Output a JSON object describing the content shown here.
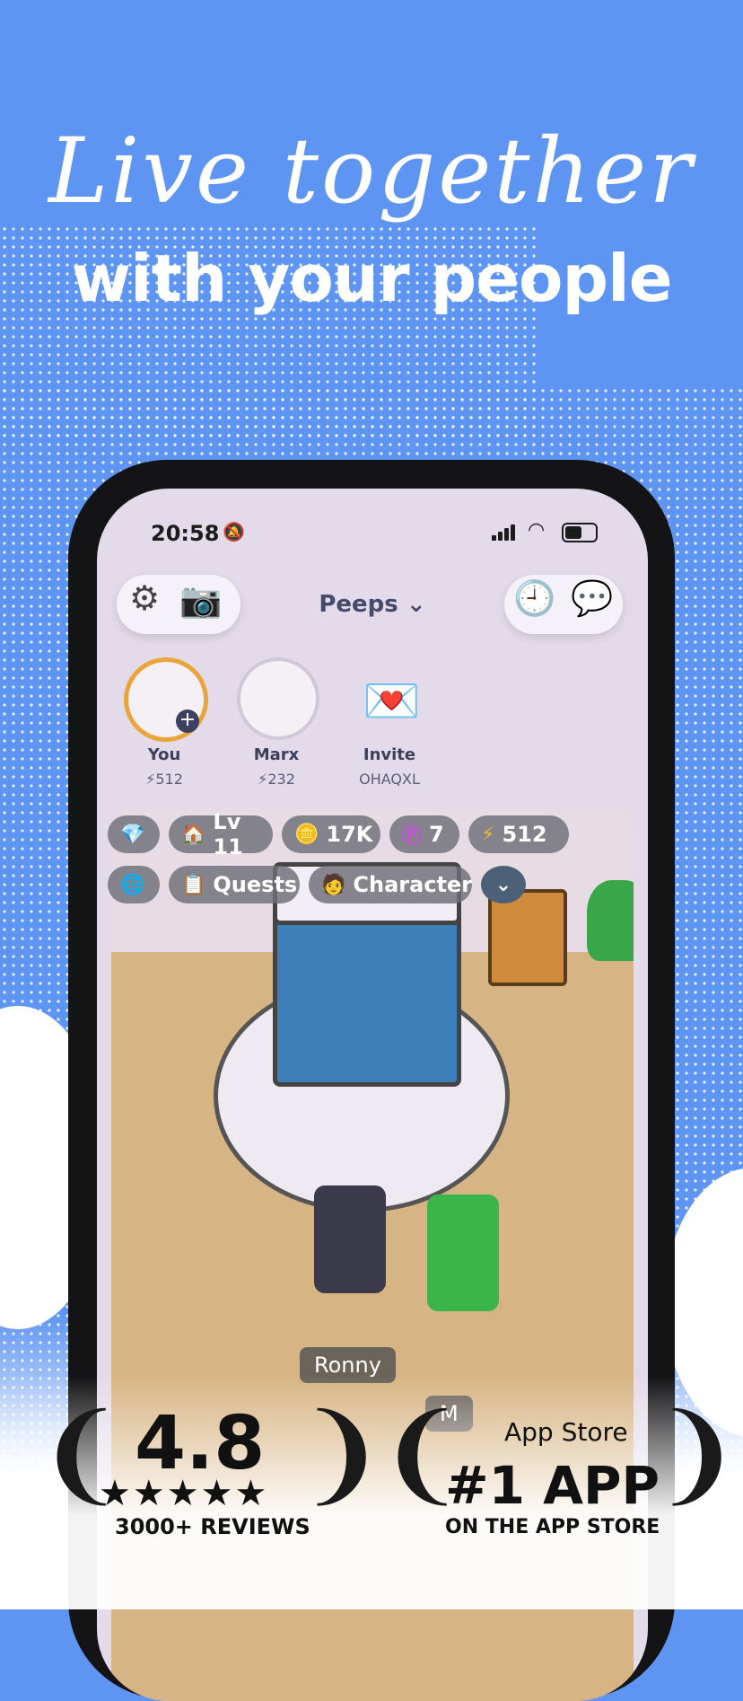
{
  "headline": {
    "line1": "Live together",
    "line2": "with your people"
  },
  "status_bar": {
    "time": "20:58"
  },
  "top_bar": {
    "title": "Peeps",
    "settings_icon": "gear-icon",
    "camera_icon": "camera-icon",
    "history_icon": "history-icon",
    "chat_icon": "chat-icon"
  },
  "people": [
    {
      "name": "You",
      "score": "512"
    },
    {
      "name": "Marx",
      "score": "232"
    },
    {
      "name": "Invite",
      "code": "OHAQXL"
    }
  ],
  "stats": {
    "level": "Lv 11",
    "coins": "17K",
    "points": "7",
    "energy": "512"
  },
  "actions": {
    "quests": "Quests",
    "character": "Character"
  },
  "room": {
    "name_tags": [
      "Ronny",
      "M"
    ]
  },
  "badges": {
    "rating": "4.8",
    "stars": "★★★★★",
    "reviews": "3000+ REVIEWS",
    "store": "App Store",
    "rank": "#1 APP",
    "rank_sub": "ON THE APP STORE"
  },
  "colors": {
    "background": "#5f95f2",
    "accent_orange": "#e9a43a"
  }
}
